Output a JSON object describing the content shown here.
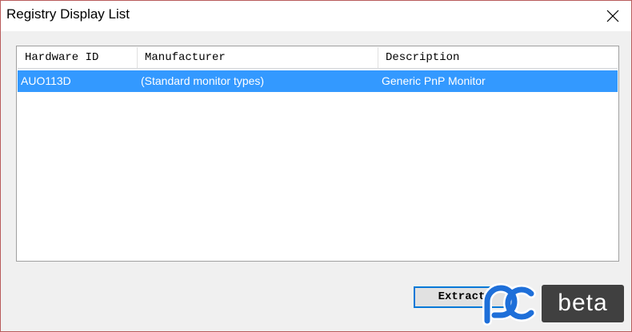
{
  "window": {
    "title": "Registry Display List",
    "close_icon": "close-icon"
  },
  "list": {
    "columns": [
      "Hardware ID",
      "Manufacturer",
      "Description"
    ],
    "rows": [
      {
        "hardware_id": "AUO113D",
        "manufacturer": "(Standard monitor types)",
        "description": "Generic PnP Monitor",
        "selected": true
      }
    ]
  },
  "buttons": {
    "extract_label": "Extract"
  },
  "watermark": {
    "logo": "pc-logo",
    "text": "beta"
  },
  "colors": {
    "selection": "#3399ff",
    "button_focus_border": "#0078d7",
    "logo_blue": "#1e6fd9",
    "badge": "#404040"
  }
}
